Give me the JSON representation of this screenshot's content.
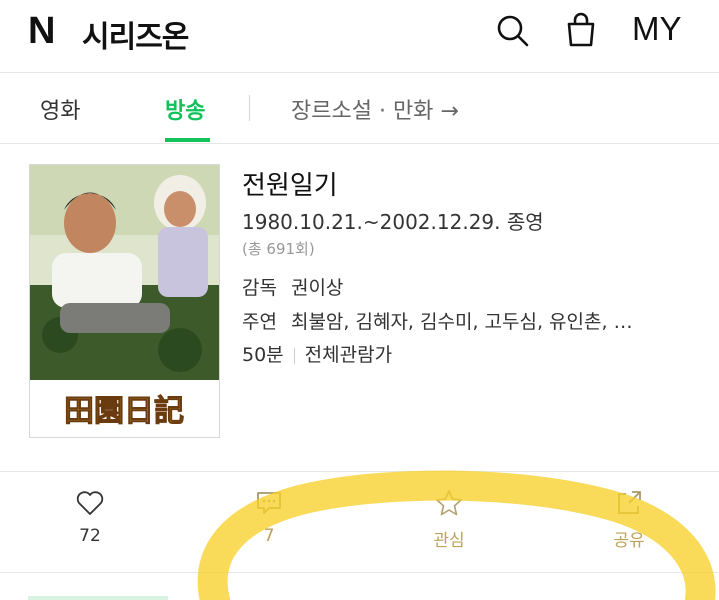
{
  "header": {
    "logo_letter": "N",
    "logo_text": "시리즈온",
    "icons": [
      "search-icon",
      "shopping-bag-icon"
    ],
    "my_label": "MY"
  },
  "tabs": {
    "items": [
      {
        "label": "영화",
        "active": false
      },
      {
        "label": "방송",
        "active": true
      }
    ],
    "more_label": "장르소설 · 만화 →",
    "accent_color": "#13c15a"
  },
  "program": {
    "title": "전원일기",
    "dates": "1980.10.21.~2002.12.29. 종영",
    "episodes": "(총 691회)",
    "director_label": "감독",
    "director": "권이상",
    "cast_label": "주연",
    "cast": "최불암, 김혜자, 김수미, 고두심, 유인촌, …",
    "runtime": "50분",
    "rating": "전체관람가",
    "poster_caption": "田園日記"
  },
  "actions": {
    "like": {
      "icon": "heart-icon",
      "count": "72"
    },
    "comment": {
      "icon": "comment-icon",
      "count": "7"
    },
    "wish": {
      "icon": "star-icon",
      "label": "관심"
    },
    "share": {
      "icon": "share-icon",
      "label": "공유"
    }
  },
  "colors": {
    "highlighter": "#f7cf2a"
  }
}
